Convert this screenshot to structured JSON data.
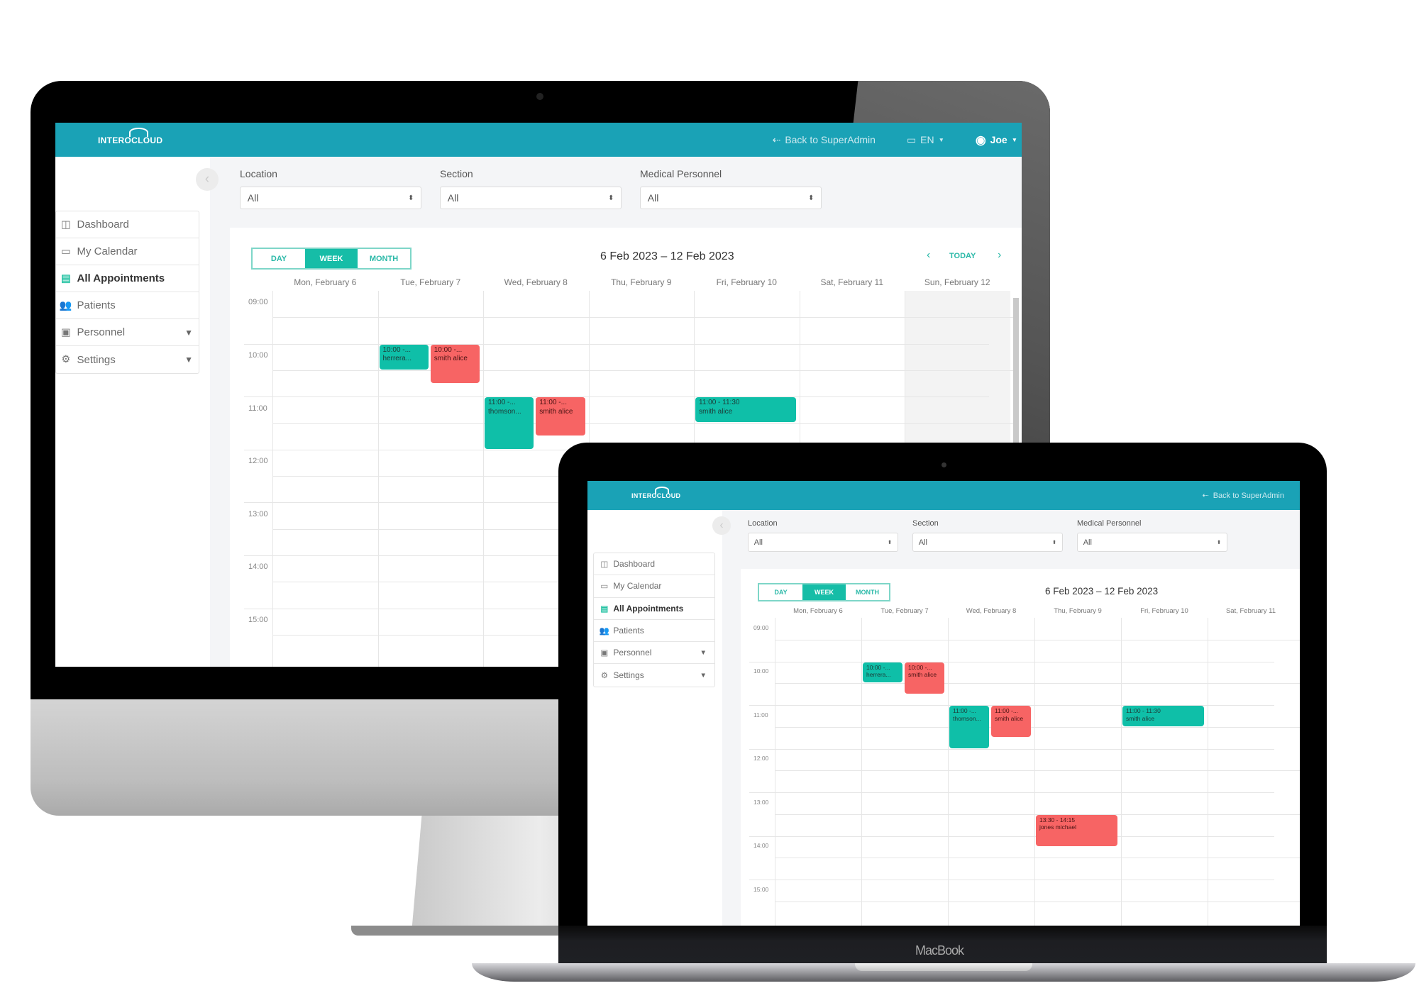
{
  "app": {
    "brand": "INTEROCLOUD",
    "header": {
      "back_label": "Back to SuperAdmin",
      "language": "EN",
      "user": "Joe"
    },
    "sidebar": {
      "items": [
        {
          "label": "Dashboard",
          "icon": "dashboard-icon",
          "glyph": "◫",
          "active": false
        },
        {
          "label": "My Calendar",
          "icon": "calendar-icon",
          "glyph": "▭",
          "active": false
        },
        {
          "label": "All Appointments",
          "icon": "appointments-icon",
          "glyph": "▤",
          "active": true
        },
        {
          "label": "Patients",
          "icon": "patients-icon",
          "glyph": "👥",
          "active": false
        },
        {
          "label": "Personnel",
          "icon": "personnel-icon",
          "glyph": "▣",
          "active": false,
          "expandable": true
        },
        {
          "label": "Settings",
          "icon": "gear-icon",
          "glyph": "⚙",
          "active": false,
          "expandable": true
        }
      ],
      "collapse_glyph": "‹"
    },
    "filters": [
      {
        "label": "Location",
        "value": "All"
      },
      {
        "label": "Section",
        "value": "All"
      },
      {
        "label": "Medical Personnel",
        "value": "All"
      }
    ],
    "calendar": {
      "views": [
        "DAY",
        "WEEK",
        "MONTH"
      ],
      "active_view": "WEEK",
      "range": "6 Feb 2023 – 12 Feb 2023",
      "today_label": "TODAY",
      "prev_glyph": "‹",
      "next_glyph": "›",
      "days": [
        "Mon, February 6",
        "Tue, February 7",
        "Wed, February 8",
        "Thu, February 9",
        "Fri, February 10",
        "Sat, February 11",
        "Sun, February 12"
      ],
      "times": [
        "09:00",
        "10:00",
        "11:00",
        "12:00",
        "13:00",
        "14:00",
        "15:00"
      ],
      "colors": {
        "teal": "#0fbfa8",
        "red": "#f76464",
        "header": "#1aa2b6"
      },
      "events": [
        {
          "day": 1,
          "start": 10.0,
          "end": 10.5,
          "slot": 0,
          "slots": 2,
          "color": "teal",
          "time": "10:00 -...",
          "name": "herrera..."
        },
        {
          "day": 1,
          "start": 10.0,
          "end": 10.75,
          "slot": 1,
          "slots": 2,
          "color": "red",
          "time": "10:00 -...",
          "name": "smith alice"
        },
        {
          "day": 2,
          "start": 11.0,
          "end": 12.0,
          "slot": 0,
          "slots": 2,
          "color": "teal",
          "time": "11:00 -...",
          "name": "thomson..."
        },
        {
          "day": 2,
          "start": 11.0,
          "end": 11.75,
          "slot": 1,
          "slots": 2,
          "color": "red",
          "time": "11:00 -...",
          "name": "smith alice"
        },
        {
          "day": 4,
          "start": 11.0,
          "end": 11.5,
          "slot": 0,
          "slots": 1,
          "color": "teal",
          "time": "11:00 - 11:30",
          "name": "smith alice"
        },
        {
          "day": 3,
          "start": 13.5,
          "end": 14.25,
          "slot": 0,
          "slots": 1,
          "color": "red",
          "time": "13:30 - 14:15",
          "name": "jones michael"
        }
      ]
    }
  },
  "devices": {
    "laptop_label": "MacBook",
    "apple_glyph": ""
  }
}
